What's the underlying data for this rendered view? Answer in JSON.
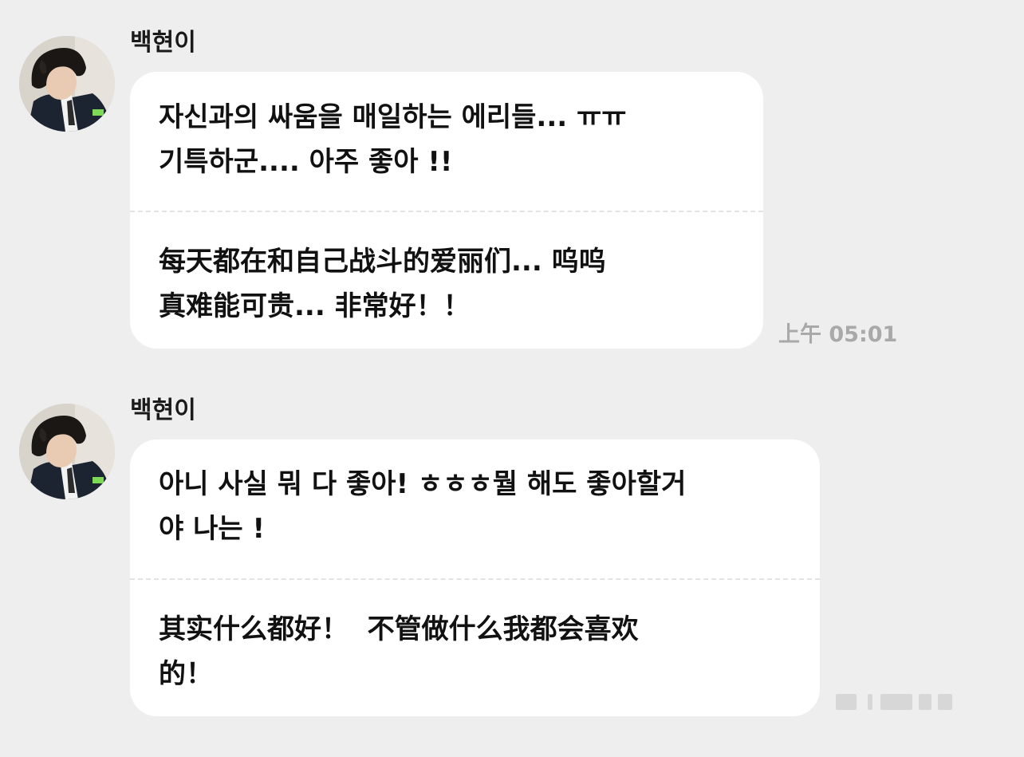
{
  "messages": [
    {
      "sender": "백현이",
      "korean": "자신과의 싸움을 매일하는 에리들... ㅠㅠ\n기특하군.... 아주 좋아 !!",
      "translation": "每天都在和自己战斗的爱丽们... 呜呜\n真难能可贵... 非常好！！",
      "time": "上午 05:01"
    },
    {
      "sender": "백현이",
      "korean": "아니 사실 뭐 다 좋아! ㅎㅎㅎ뭘 해도 좋아할거\n야 나는 !",
      "translation": "其实什么都好！  不管做什么我都会喜欢\n的！"
    }
  ],
  "colors": {
    "background": "#eeeeee",
    "bubble": "#ffffff",
    "timestamp": "#a9a9a9"
  }
}
